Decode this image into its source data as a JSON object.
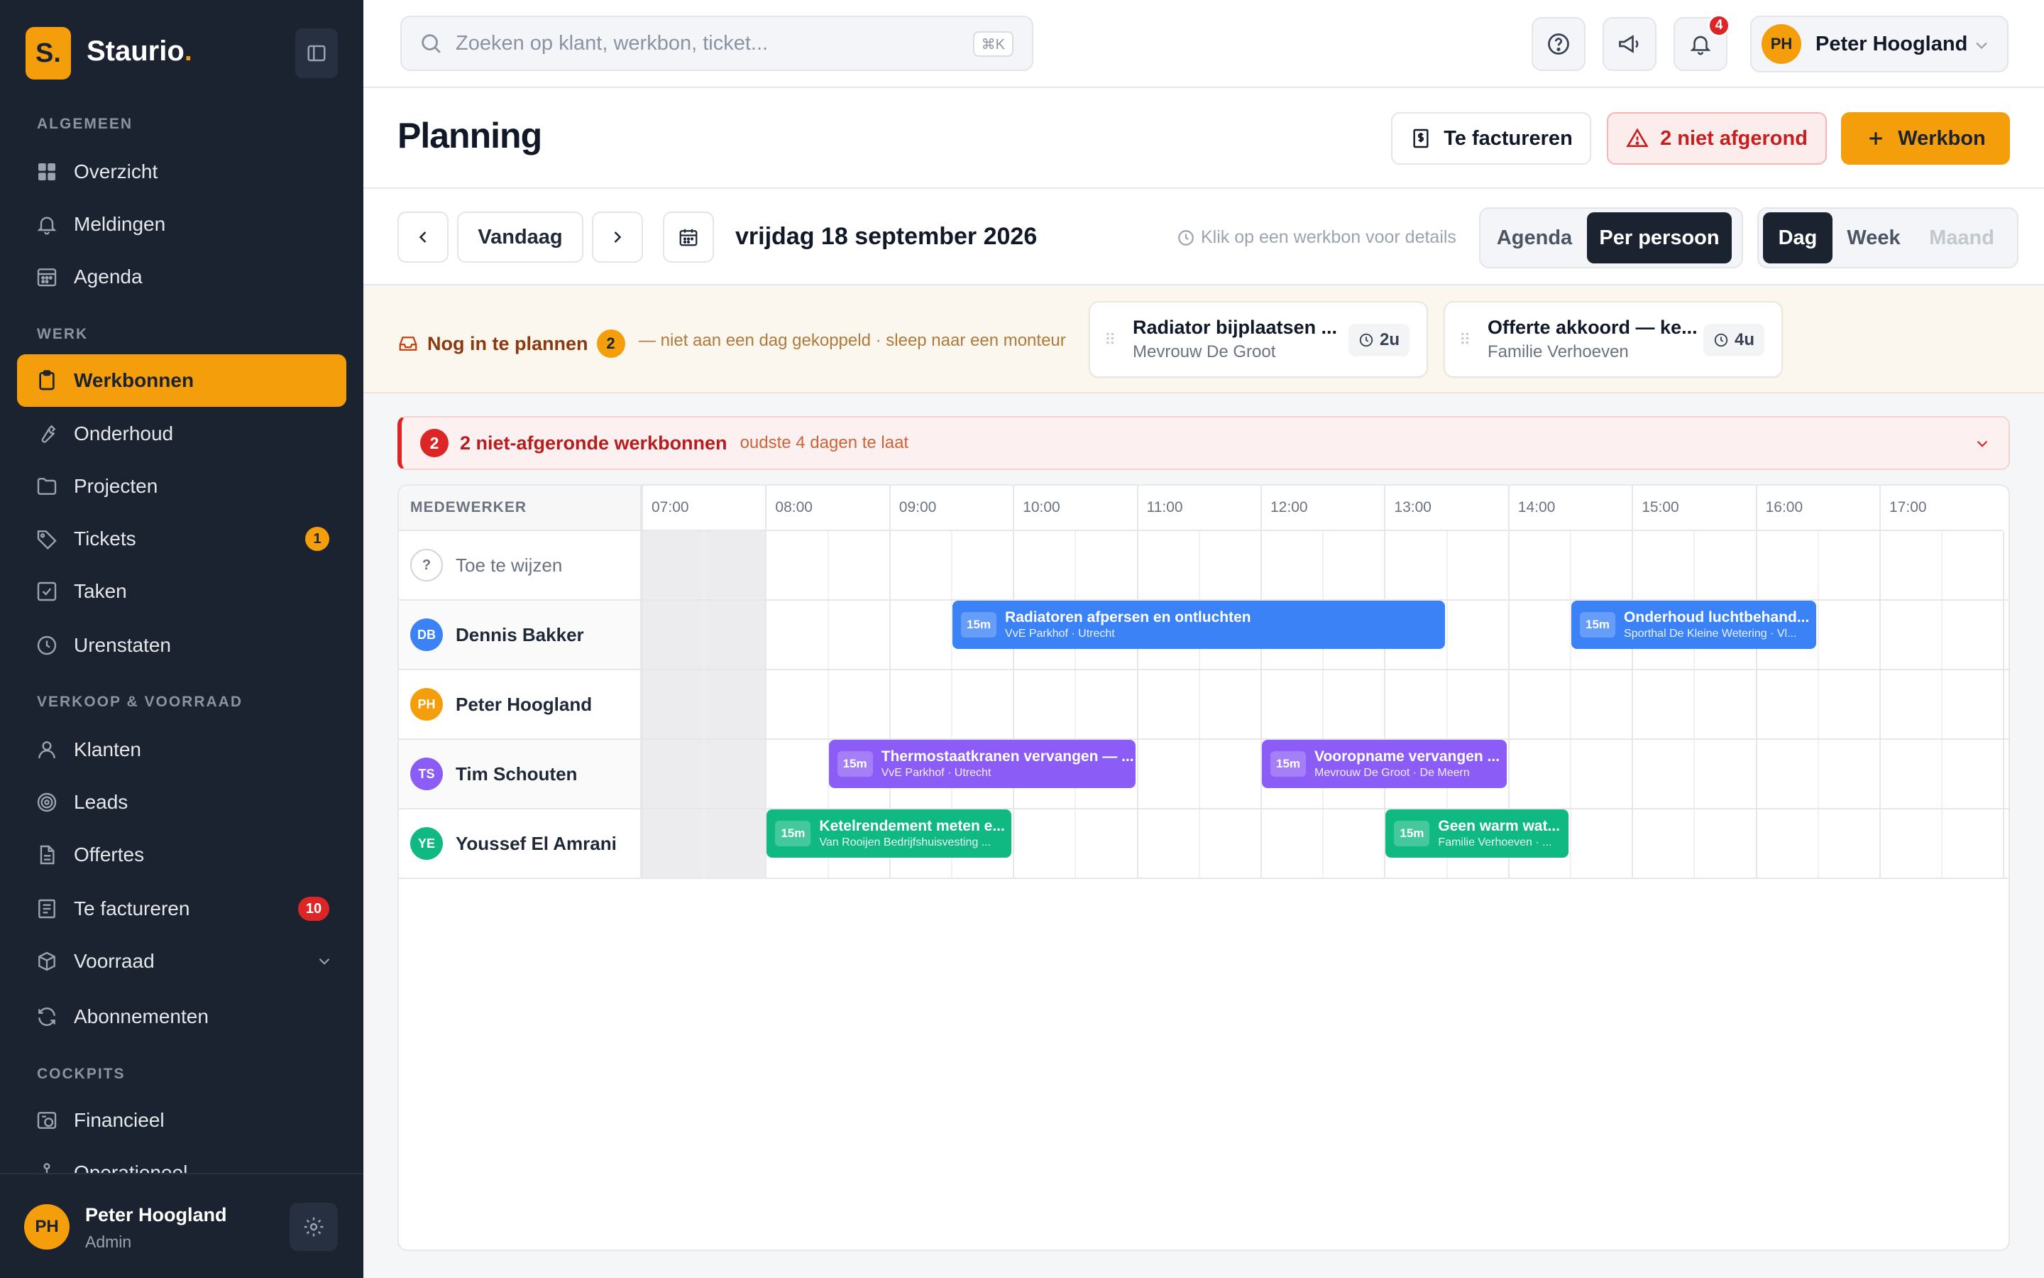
{
  "app": {
    "logo_letter": "S.",
    "name": "Staurio",
    "name_dot": "."
  },
  "sidebar": {
    "sections": [
      {
        "title": "ALGEMEEN"
      },
      {
        "title": "WERK"
      },
      {
        "title": "VERKOOP & VOORRAAD"
      },
      {
        "title": "COCKPITS"
      }
    ],
    "items": [
      {
        "label": "Overzicht",
        "icon": "grid-icon"
      },
      {
        "label": "Meldingen",
        "icon": "bell-icon"
      },
      {
        "label": "Agenda",
        "icon": "calendar-icon"
      },
      {
        "label": "Werkbonnen",
        "icon": "clipboard-icon",
        "active": true
      },
      {
        "label": "Onderhoud",
        "icon": "wrench-icon"
      },
      {
        "label": "Projecten",
        "icon": "folder-icon"
      },
      {
        "label": "Tickets",
        "icon": "tag-icon",
        "badge": "1"
      },
      {
        "label": "Taken",
        "icon": "checkbox-icon"
      },
      {
        "label": "Urenstaten",
        "icon": "clock-icon"
      },
      {
        "label": "Klanten",
        "icon": "user-icon"
      },
      {
        "label": "Leads",
        "icon": "target-icon"
      },
      {
        "label": "Offertes",
        "icon": "document-icon"
      },
      {
        "label": "Te factureren",
        "icon": "invoice-icon",
        "badge": "10"
      },
      {
        "label": "Voorraad",
        "icon": "box-icon"
      },
      {
        "label": "Abonnementen",
        "icon": "refresh-icon"
      },
      {
        "label": "Financieel",
        "icon": "finance-icon"
      },
      {
        "label": "Operationeel",
        "icon": "network-icon"
      }
    ],
    "user": {
      "initials": "PH",
      "name": "Peter Hoogland",
      "role": "Admin"
    }
  },
  "topbar": {
    "search_placeholder": "Zoeken op klant, werkbon, ticket...",
    "search_shortcut": "⌘K",
    "notification_count": "4",
    "user_initials": "PH",
    "user_name": "Peter Hoogland"
  },
  "header": {
    "title": "Planning",
    "btn_invoice": "Te factureren",
    "btn_unfinished": "2 niet afgerond",
    "btn_new": "Werkbon"
  },
  "toolbar": {
    "today": "Vandaag",
    "date": "vrijdag 18 september 2026",
    "hint": "Klik op een werkbon voor details",
    "view_modes": [
      "Agenda",
      "Per persoon"
    ],
    "view_selected": "Per persoon",
    "ranges": [
      "Dag",
      "Week",
      "Maand"
    ],
    "range_selected": "Dag"
  },
  "unplanned": {
    "title": "Nog in te plannen",
    "count": "2",
    "subtitle": "— niet aan een dag gekoppeld · sleep naar een monteur",
    "cards": [
      {
        "title": "Radiator bijplaatsen ...",
        "client": "Mevrouw De Groot",
        "duration": "2u"
      },
      {
        "title": "Offerte akkoord — ke...",
        "client": "Familie Verhoeven",
        "duration": "4u"
      }
    ]
  },
  "alert": {
    "count": "2",
    "title": "2 niet-afgeronde werkbonnen",
    "subtitle": "oudste 4 dagen te laat"
  },
  "schedule": {
    "column_header": "MEDEWERKER",
    "hours": [
      "07:00",
      "08:00",
      "09:00",
      "10:00",
      "11:00",
      "12:00",
      "13:00",
      "14:00",
      "15:00",
      "16:00",
      "17:00"
    ],
    "rows": [
      {
        "name": "Toe te wijzen",
        "initials": "?",
        "color": ""
      },
      {
        "name": "Dennis Bakker",
        "initials": "DB",
        "color": "#3b82f6"
      },
      {
        "name": "Peter Hoogland",
        "initials": "PH",
        "color": "#f59e0b"
      },
      {
        "name": "Tim Schouten",
        "initials": "TS",
        "color": "#8b5cf6"
      },
      {
        "name": "Youssef El Amrani",
        "initials": "YE",
        "color": "#10b981"
      }
    ],
    "events": [
      {
        "row": 1,
        "start": 9.5,
        "end": 13.5,
        "tag": "15m",
        "title": "Radiatoren afpersen en ontluchten",
        "sub": "VvE Parkhof · Utrecht",
        "color": "#3b82f6"
      },
      {
        "row": 1,
        "start": 14.5,
        "end": 16.5,
        "tag": "15m",
        "title": "Onderhoud luchtbehand...",
        "sub": "Sporthal De Kleine Wetering · Vl...",
        "color": "#3b82f6"
      },
      {
        "row": 3,
        "start": 8.5,
        "end": 11.0,
        "tag": "15m",
        "title": "Thermostaatkranen vervangen — ...",
        "sub": "VvE Parkhof · Utrecht",
        "color": "#8b5cf6"
      },
      {
        "row": 3,
        "start": 12.0,
        "end": 14.0,
        "tag": "15m",
        "title": "Vooropname vervangen ...",
        "sub": "Mevrouw De Groot · De Meern",
        "color": "#8b5cf6"
      },
      {
        "row": 4,
        "start": 8.0,
        "end": 10.0,
        "tag": "15m",
        "title": "Ketelrendement meten e...",
        "sub": "Van Rooijen Bedrijfshuisvesting ...",
        "color": "#10b981"
      },
      {
        "row": 4,
        "start": 13.0,
        "end": 14.5,
        "tag": "15m",
        "title": "Geen warm wat...",
        "sub": "Familie Verhoeven · ...",
        "color": "#10b981"
      }
    ]
  }
}
